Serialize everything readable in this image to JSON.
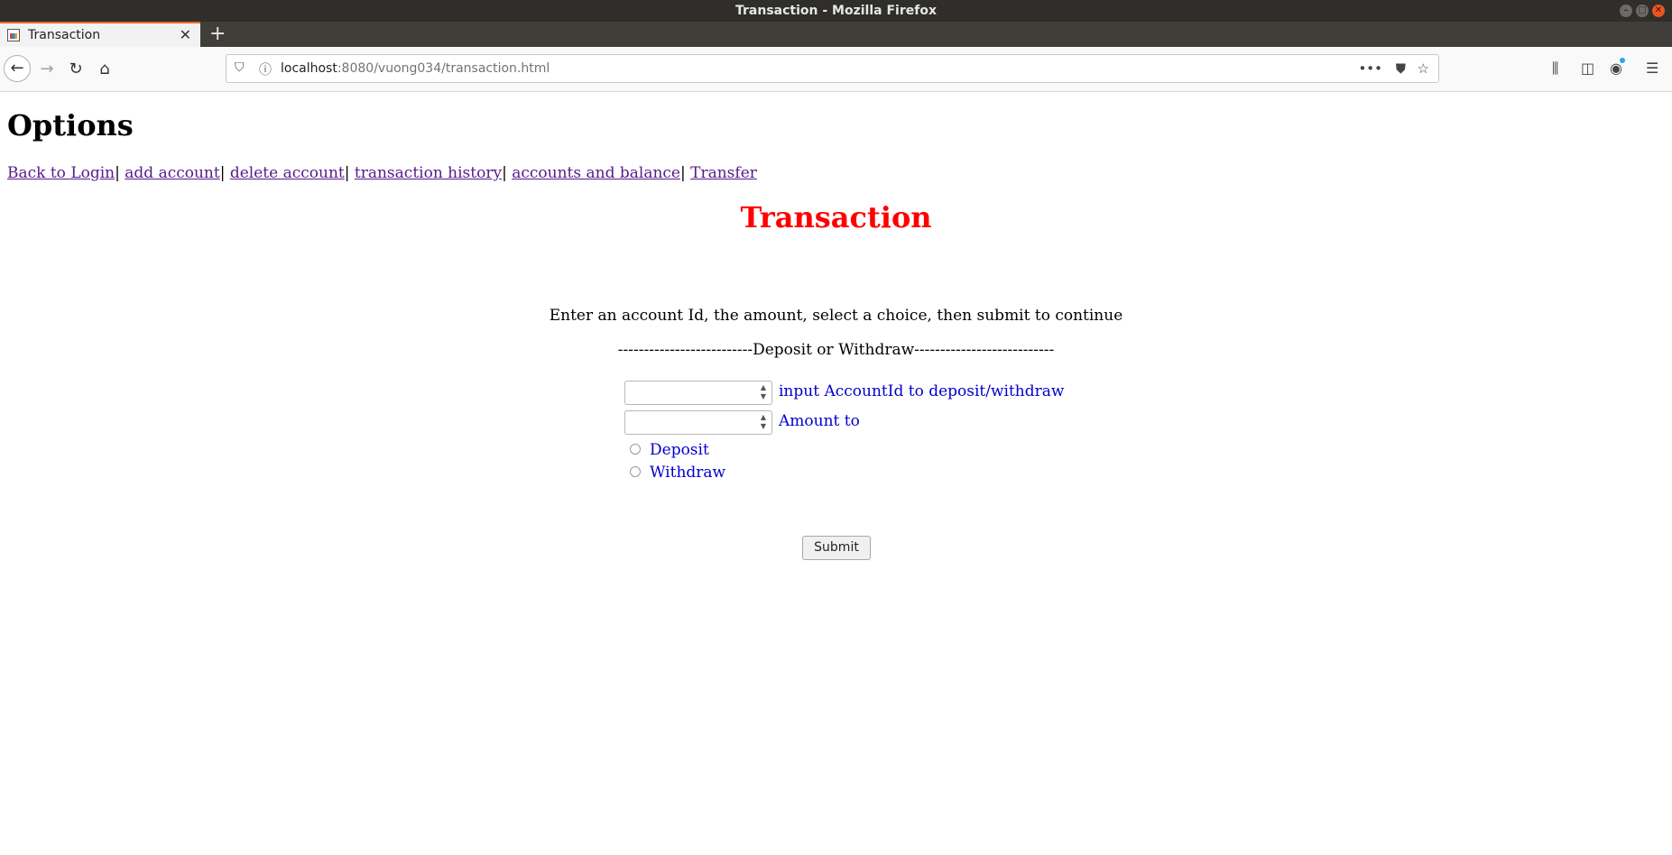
{
  "window": {
    "title": "Transaction - Mozilla Firefox"
  },
  "tab": {
    "label": "Transaction",
    "close_glyph": "✕",
    "new_tab_glyph": "+"
  },
  "navbar": {
    "url_host": "localhost",
    "url_rest": ":8080/vuong034/transaction.html",
    "icons": [
      "back-arrow-icon",
      "forward-arrow-icon",
      "reload-icon",
      "home-icon",
      "shield-icon",
      "info-icon",
      "more-dots-icon",
      "pocket-icon",
      "star-icon",
      "library-icon",
      "sidebar-icon",
      "account-icon",
      "hamburger-menu-icon"
    ]
  },
  "page": {
    "options_heading": "Options",
    "links": [
      {
        "label": "Back to Login",
        "sep": "| "
      },
      {
        "label": "add account",
        "sep": "| "
      },
      {
        "label": "delete account",
        "sep": "| "
      },
      {
        "label": "transaction history",
        "sep": "| "
      },
      {
        "label": "accounts and balance",
        "sep": "| "
      },
      {
        "label": "Transfer",
        "sep": ""
      }
    ],
    "transaction_heading": "Transaction",
    "instructions": "Enter an account Id, the amount, select a choice, then submit to continue",
    "divider": "--------------------------Deposit or Withdraw---------------------------",
    "account_id_label": "input AccountId to deposit/withdraw",
    "account_id_value": "",
    "amount_label": "Amount to",
    "amount_value": "",
    "radio_deposit": "Deposit",
    "radio_withdraw": "Withdraw",
    "submit_label": "Submit"
  },
  "colors": {
    "heading_red": "#ff0000",
    "link_visited": "#551a8b",
    "label_blue": "#0000cd",
    "tab_accent": "#e76a2a"
  }
}
